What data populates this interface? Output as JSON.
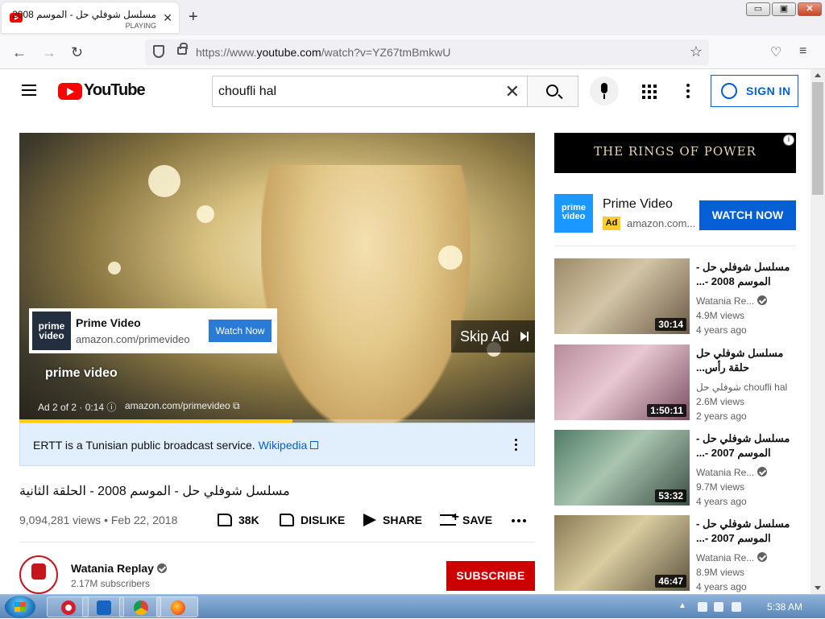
{
  "browser": {
    "tab_title": "مسلسل شوفلي حل - الموسم 2008",
    "tab_subtitle": "PLAYING",
    "url_prefix": "https://www.",
    "url_domain": "youtube.com",
    "url_path": "/watch?v=YZ67tmBmkwU",
    "window_min": "▭",
    "window_max": "▣",
    "window_close": "✕"
  },
  "masthead": {
    "logo_text": "YouTube",
    "search_value": "choufli hal",
    "sign_in_label": "SIGN IN"
  },
  "player": {
    "ad_card_title": "Prime Video",
    "ad_card_domain": "amazon.com/primevideo",
    "ad_card_button": "Watch Now",
    "skip_label": "Skip Ad",
    "watermark": "prime video",
    "ad_meta": "Ad 2 of 2 · 0:14 ⓘ",
    "ad_domain": "amazon.com/primevideo ⧉",
    "progress_fraction": 0.53,
    "logo_text": "prime video"
  },
  "info_panel": {
    "text": "ERTT is a Tunisian public broadcast service. ",
    "link": "Wikipedia"
  },
  "video": {
    "title": "مسلسل شوفلي حل - الموسم 2008 - الحلقة الثانية",
    "stats": "9,094,281 views • Feb 22, 2018",
    "like_count": "38K",
    "dislike_label": "DISLIKE",
    "share_label": "SHARE",
    "save_label": "SAVE"
  },
  "channel": {
    "name": "Watania Replay",
    "subscribers": "2.17M subscribers",
    "subscribe_label": "SUBSCRIBE"
  },
  "sidebar": {
    "banner_text": "THE RINGS OF POWER",
    "banner_info": "i",
    "ad": {
      "title": "Prime Video",
      "badge": "Ad",
      "domain": "amazon.com...",
      "cta": "WATCH NOW",
      "logo_text": "prime video"
    },
    "recommendations": [
      {
        "title": "مسلسل شوفلي حل - الموسم 2008 -...",
        "channel": "Watania Re...",
        "verified": true,
        "views": "4.9M views",
        "age": "4 years ago",
        "duration": "30:14"
      },
      {
        "title": "مسلسل شوفلي حل حلقة رأس...",
        "channel": "شوفلي حل choufli hal",
        "verified": false,
        "views": "2.6M views",
        "age": "2 years ago",
        "duration": "1:50:11"
      },
      {
        "title": "مسلسل شوفلي حل - الموسم 2007 -...",
        "channel": "Watania Re...",
        "verified": true,
        "views": "9.7M views",
        "age": "4 years ago",
        "duration": "53:32"
      },
      {
        "title": "مسلسل شوفلي حل - الموسم 2007 -...",
        "channel": "Watania Re...",
        "verified": true,
        "views": "8.9M views",
        "age": "4 years ago",
        "duration": "46:47"
      }
    ]
  },
  "taskbar": {
    "clock": "5:38 AM"
  },
  "colors": {
    "brand_red": "#ff0000",
    "link_blue": "#065fd4",
    "subscribe_red": "#cc0000",
    "ad_yellow": "#ffcc00"
  }
}
